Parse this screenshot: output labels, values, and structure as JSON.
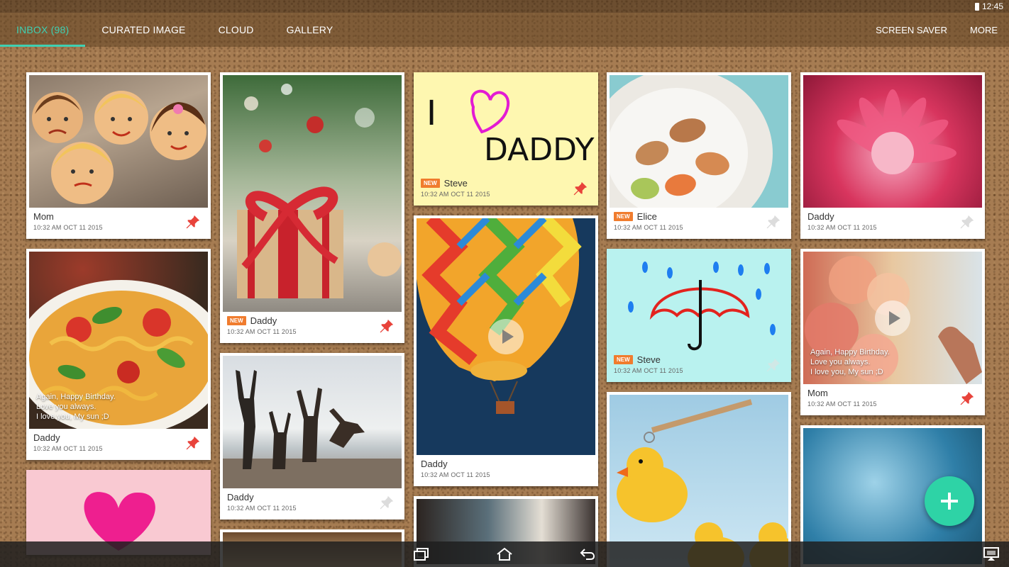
{
  "status": {
    "time": "12:45"
  },
  "tabs": [
    {
      "label": "INBOX (98)",
      "active": true
    },
    {
      "label": "CURATED IMAGE",
      "active": false
    },
    {
      "label": "CLOUD",
      "active": false
    },
    {
      "label": "GALLERY",
      "active": false
    }
  ],
  "actions": {
    "screen_saver": "SCREEN SAVER",
    "more": "MORE"
  },
  "accent_color": "#3fd0b2",
  "fab_color": "#2ed3a6",
  "badge": "NEW",
  "posts": {
    "c1": [
      {
        "name": "Mom",
        "date": "10:32 AM OCT 11 2015",
        "pinned": true
      },
      {
        "name": "Daddy",
        "date": "10:32 AM OCT 11 2015",
        "pinned": true,
        "message": [
          "Again, Happy Birthday.",
          "Love you always.",
          "I love you, My sun ;D"
        ]
      }
    ],
    "c2": [
      {
        "name": "Daddy",
        "date": "10:32 AM OCT 11 2015",
        "pinned": true,
        "new": true
      },
      {
        "name": "Daddy",
        "date": "10:32 AM OCT 11 2015",
        "pinned": false
      }
    ],
    "c3": [
      {
        "name": "Steve",
        "date": "10:32 AM OCT 11 2015",
        "pinned": true,
        "new": true,
        "drawing_text": [
          "I",
          "DADDY"
        ]
      },
      {
        "name": "Daddy",
        "date": "10:32 AM OCT 11 2015",
        "pinned": false,
        "video": true
      }
    ],
    "c4": [
      {
        "name": "Elice",
        "date": "10:32 AM OCT 11 2015",
        "pinned": false,
        "new": true
      },
      {
        "name": "Steve",
        "date": "10:32 AM OCT 11 2015",
        "pinned": false,
        "new": true
      }
    ],
    "c5": [
      {
        "name": "Daddy",
        "date": "10:32 AM OCT 11 2015",
        "pinned": false
      },
      {
        "name": "Mom",
        "date": "10:32 AM OCT 11 2015",
        "pinned": true,
        "video": true,
        "message": [
          "Again, Happy Birthday.",
          "Love you always.",
          "I love you, My sun ;D"
        ]
      }
    ]
  },
  "icons": {
    "pin": "pushpin-icon",
    "play": "play-icon",
    "fab": "plus-icon",
    "recents": "recent-apps-icon",
    "home": "home-icon",
    "back": "back-icon",
    "cast": "screen-mirror-icon"
  }
}
